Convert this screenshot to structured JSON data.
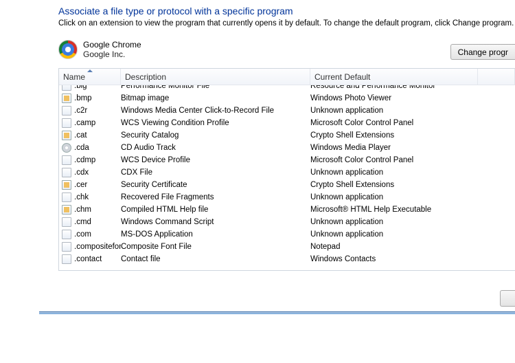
{
  "header": {
    "title": "Associate a file type or protocol with a specific program",
    "subtitle": "Click on an extension to view the program that currently opens it by default. To change the default program, click Change program."
  },
  "selected_program": {
    "name": "Google Chrome",
    "publisher": "Google Inc."
  },
  "buttons": {
    "change_program": "Change progr"
  },
  "columns": {
    "name": "Name",
    "description": "Description",
    "current_default": "Current Default"
  },
  "rows": [
    {
      "ext": ".blg",
      "desc": "Performance Monitor File",
      "def": "Resource and Performance Monitor",
      "icon": "doc"
    },
    {
      "ext": ".bmp",
      "desc": "Bitmap image",
      "def": "Windows Photo Viewer",
      "icon": "special"
    },
    {
      "ext": ".c2r",
      "desc": "Windows Media Center Click-to-Record File",
      "def": "Unknown application",
      "icon": "doc"
    },
    {
      "ext": ".camp",
      "desc": "WCS Viewing Condition Profile",
      "def": "Microsoft Color Control Panel",
      "icon": "doc"
    },
    {
      "ext": ".cat",
      "desc": "Security Catalog",
      "def": "Crypto Shell Extensions",
      "icon": "special"
    },
    {
      "ext": ".cda",
      "desc": "CD Audio Track",
      "def": "Windows Media Player",
      "icon": "cd"
    },
    {
      "ext": ".cdmp",
      "desc": "WCS Device Profile",
      "def": "Microsoft Color Control Panel",
      "icon": "doc"
    },
    {
      "ext": ".cdx",
      "desc": "CDX File",
      "def": "Unknown application",
      "icon": "doc"
    },
    {
      "ext": ".cer",
      "desc": "Security Certificate",
      "def": "Crypto Shell Extensions",
      "icon": "special"
    },
    {
      "ext": ".chk",
      "desc": "Recovered File Fragments",
      "def": "Unknown application",
      "icon": "doc"
    },
    {
      "ext": ".chm",
      "desc": "Compiled HTML Help file",
      "def": "Microsoft® HTML Help Executable",
      "icon": "special"
    },
    {
      "ext": ".cmd",
      "desc": "Windows Command Script",
      "def": "Unknown application",
      "icon": "doc"
    },
    {
      "ext": ".com",
      "desc": "MS-DOS Application",
      "def": "Unknown application",
      "icon": "doc"
    },
    {
      "ext": ".compositefont",
      "desc": "Composite Font File",
      "def": "Notepad",
      "icon": "doc"
    },
    {
      "ext": ".contact",
      "desc": "Contact file",
      "def": "Windows Contacts",
      "icon": "doc"
    }
  ]
}
